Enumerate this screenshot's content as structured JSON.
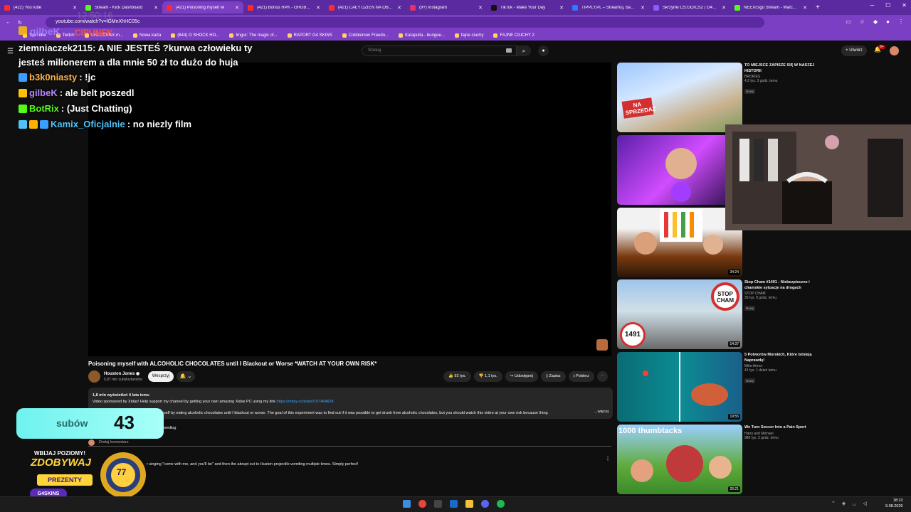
{
  "browser": {
    "tabs": [
      {
        "title": "(422) YouTube",
        "color": "#ff2b2b"
      },
      {
        "title": "Stream - Kick Dashboard",
        "color": "#53fc18"
      },
      {
        "title": "(421) Poisoning myself wi",
        "color": "#ff2b2b",
        "active": true
      },
      {
        "title": "(421) Bonus RPK - GRUBA IM",
        "color": "#ff2b2b"
      },
      {
        "title": "(421) CAŁY DZIEŃ NA OBOZIE",
        "color": "#ff2b2b"
      },
      {
        "title": "(9+) Instagram",
        "color": "#e1306c"
      },
      {
        "title": "TikTok - Make Your Day",
        "color": "#111111"
      },
      {
        "title": "TIPPLY.PL – Streamuj, baw się",
        "color": "#2f7bff"
      },
      {
        "title": "Skrzynki CS:GO/CS2 | G4Skin",
        "color": "#8a5cff"
      },
      {
        "title": "NEEXcsgo Stream - Watch Li",
        "color": "#53fc18"
      }
    ],
    "url": "youtube.com/watch?v=lGMnXhHC05c",
    "bookmarks": [
      "YouTube",
      "Twitch",
      "UNLOCKhiX.m...",
      "Nowa karta",
      "(644) G SHOCK HO...",
      "Imgur: The magic of...",
      "RAPORT G4 SKINS",
      "Cobblemon Freedo...",
      "Katapulta - bungee...",
      "fajne ciuchy",
      "FAJNE CIUCHY 2"
    ]
  },
  "youtube": {
    "search_placeholder": "Szukaj",
    "create_label": "Utwórz",
    "notif_count": "9+",
    "video_title": "Poisoning myself with ALCOHOLIC CHOCOLATES until I Blackout or Worse *WATCH AT YOUR OWN RISK*",
    "channel_name": "Houston Jones",
    "channel_subs": "5,87 mln subskrybentów",
    "support_label": "Wesprzyj",
    "likes": "92 tys.",
    "dislikes": "1,1 tys.",
    "share_label": "Udostępnij",
    "save_label": "Zapisz",
    "download_label": "Pobierz",
    "desc_meta": "1,8 mln wyświetleń  4 lata temu",
    "desc_line1": "Video sponsored by Xidax! Help support my channel by getting your own amazing Xidax PC using my link",
    "desc_link": "https://mbsy.co/xidax/107464628",
    "desc_line2": "on myself by eating alcoholic chocolates until I blackout or worse. The goal of this experiment was to find out if it was possible to get drunk from alcoholic chocolates, but you should watch this video at your own risk because things get a little bi",
    "desc_more": "...więcej",
    "sort_label": "według",
    "add_comment": "Dodaj komentarz",
    "comment_text": "r singing \"come with me, and you'll be\" and then the abrupt cut to Huston projectile vomiting multiple times. Simply perfect!"
  },
  "related": [
    {
      "title": "TO MIEJSCE ZAPISZE SIĘ W NASZEJ HISTORII",
      "channel": "BROKIES",
      "views": "4,2 tys.  3 godz. temu",
      "badge": "Nowy",
      "thumb_text": "NA SPRZEDAŻ",
      "duration": ""
    },
    {
      "title": "",
      "channel": "",
      "views": "",
      "badge": "",
      "thumb_text": "",
      "duration": ""
    },
    {
      "title": "",
      "channel": "",
      "views": "",
      "badge": "",
      "thumb_text": "",
      "duration": "34:24"
    },
    {
      "title": "Stop Cham #1491 - Niebezpieczne i chamskie sytuacje na drogach",
      "channel": "STOP CHAM",
      "views": "30 tys.  9 godz. temu",
      "badge": "Nowy",
      "thumb_text": "STOP CHAM",
      "thumb_num": "1491",
      "duration": "14:37"
    },
    {
      "title": "5 Potworów Morskich, Które Istnieją Naprawdę!",
      "channel": "Mike Armor",
      "views": "41 tys.  1 dzień temu",
      "badge": "Nowy",
      "thumb_text": "",
      "duration": "19:55"
    },
    {
      "title": "We Turn Soccer Into a Pain Sport",
      "channel": "Harry and Michael",
      "views": "980 tys.  3 godz. temu",
      "badge": "",
      "thumb_text": "1000 thumbtacks",
      "duration": "26:21"
    }
  ],
  "chat": {
    "ghost_name": "gilbeK",
    "ghost_top": "12:50:16",
    "ghost_red": "CIPUNEK",
    "messages": [
      {
        "user": "ziemniaczek2115",
        "text": ": A NIE JESTEŚ ?kurwa człowieku ty jesteś milionerem a dla mnie 50 zł to dużo do huja",
        "color": "#ffffff"
      },
      {
        "user": "b3k0niasty",
        "text": ": !jc",
        "color": "#ffb347"
      },
      {
        "user": "gilbeK",
        "text": ": ale belt poszedl",
        "color": "#b388ff"
      },
      {
        "user": "BotRix",
        "text": ": (Just Chatting)",
        "color": "#53fc18"
      },
      {
        "user": "Kamix_Oficjalnie",
        "text": ": no niezly film",
        "color": "#4fc3f7"
      }
    ]
  },
  "overlay": {
    "sub_label": "subów",
    "sub_count": "43",
    "promo_line1": "WBIJAJ POZIOMY!",
    "promo_line2": "ZDOBYWAJ",
    "promo_line3": "PREZENTY",
    "promo_logo": "G4SKINS",
    "promo_level": "77"
  },
  "taskbar": {
    "time": "18:13",
    "date": "9.08.2026"
  }
}
